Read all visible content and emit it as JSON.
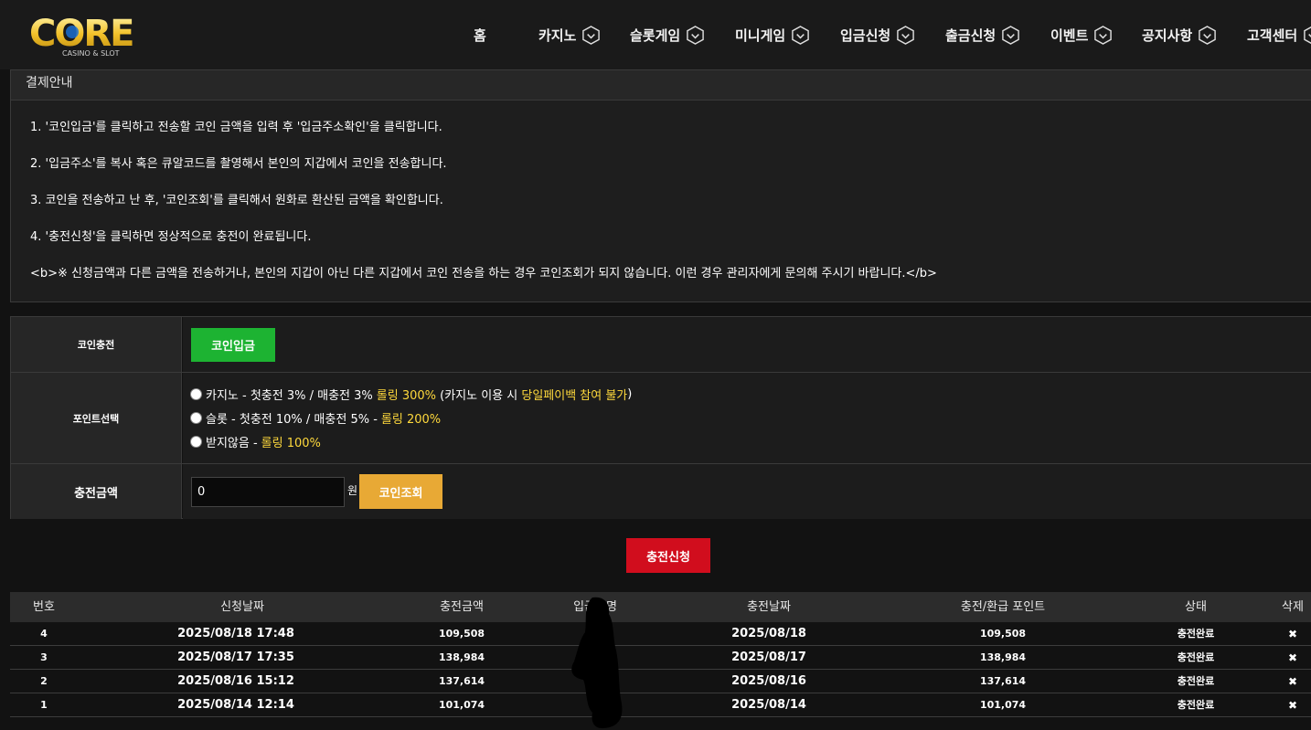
{
  "header": {
    "logo_text": "CORE",
    "logo_sub": "CASINO & SLOT",
    "nav": [
      {
        "label": "홈",
        "icon": ""
      },
      {
        "label": "카지노",
        "icon": "chevron-down-icon"
      },
      {
        "label": "슬롯게임",
        "icon": "chevron-down-icon"
      },
      {
        "label": "미니게임",
        "icon": "chevron-down-icon"
      },
      {
        "label": "입금신청",
        "icon": "chevron-down-icon"
      },
      {
        "label": "출금신청",
        "icon": "chevron-down-icon"
      },
      {
        "label": "이벤트",
        "icon": "chevron-down-icon"
      },
      {
        "label": "공지사항",
        "icon": "chevron-down-icon"
      },
      {
        "label": "고객센터",
        "icon": "chevron-down-icon"
      }
    ]
  },
  "guide": {
    "title": "결제안내",
    "lines": [
      "1. '코인입금'를 클릭하고 전송할 코인 금액을 입력 후 '입금주소확인'을 클릭합니다.",
      "2. '입금주소'를 복사 혹은 큐알코드를 촬영해서 본인의 지갑에서 코인을 전송합니다.",
      "3. 코인을 전송하고 난 후, '코인조회'를 클릭해서 원화로 환산된 금액을 확인합니다.",
      "4. '충전신청'을 클릭하면 정상적으로 충전이 완료됩니다.",
      "<b>※ 신청금액과 다른 금액을 전송하거나, 본인의 지갑이 아닌 다른 지갑에서 코인 전송을 하는 경우 코인조회가 되지 않습니다. 이런 경우 관리자에게 문의해 주시기 바랍니다.</b>"
    ]
  },
  "form": {
    "coin_label": "코인충전",
    "coin_button": "코인입금",
    "point_label": "포인트선택",
    "options": [
      {
        "text": "카지노 - 첫충전 3% / 매충전 3%",
        "highlight": "롤링 300%",
        "note_pre": " (카지노 이용 시 ",
        "note_hl": "당일페이백 참여 불가",
        "note_post": ")"
      },
      {
        "text": "슬롯 - 첫충전 10% / 매충전 5% -",
        "highlight": "롤링 200%",
        "note_pre": "",
        "note_hl": "",
        "note_post": ""
      },
      {
        "text": "받지않음 -",
        "highlight": "롤링 100%",
        "note_pre": "",
        "note_hl": "",
        "note_post": ""
      }
    ],
    "amount_label": "충전금액",
    "amount_value": "0",
    "currency": "원",
    "lookup_button": "코인조회",
    "submit_button": "충전신청"
  },
  "history": {
    "headers": [
      "번호",
      "신청날짜",
      "충전금액",
      "입금자명",
      "충전날짜",
      "충전/환급 포인트",
      "상태",
      "삭제"
    ],
    "rows": [
      {
        "no": "4",
        "requested": "2025/08/18 17:48",
        "amount": "109,508",
        "charged": "2025/08/18",
        "points": "109,508",
        "status": "충전완료",
        "delete": "✖"
      },
      {
        "no": "3",
        "requested": "2025/08/17 17:35",
        "amount": "138,984",
        "charged": "2025/08/17",
        "points": "138,984",
        "status": "충전완료",
        "delete": "✖"
      },
      {
        "no": "2",
        "requested": "2025/08/16 15:12",
        "amount": "137,614",
        "charged": "2025/08/16",
        "points": "137,614",
        "status": "충전완료",
        "delete": "✖"
      },
      {
        "no": "1",
        "requested": "2025/08/14 12:14",
        "amount": "101,074",
        "charged": "2025/08/14",
        "points": "101,074",
        "status": "충전완료",
        "delete": "✖"
      }
    ]
  },
  "colors": {
    "accent_green": "#1db332",
    "accent_orange": "#e8a935",
    "accent_red": "#d10d1d",
    "highlight_yellow": "#ffd93c",
    "logo_gold": "#f0c030"
  }
}
